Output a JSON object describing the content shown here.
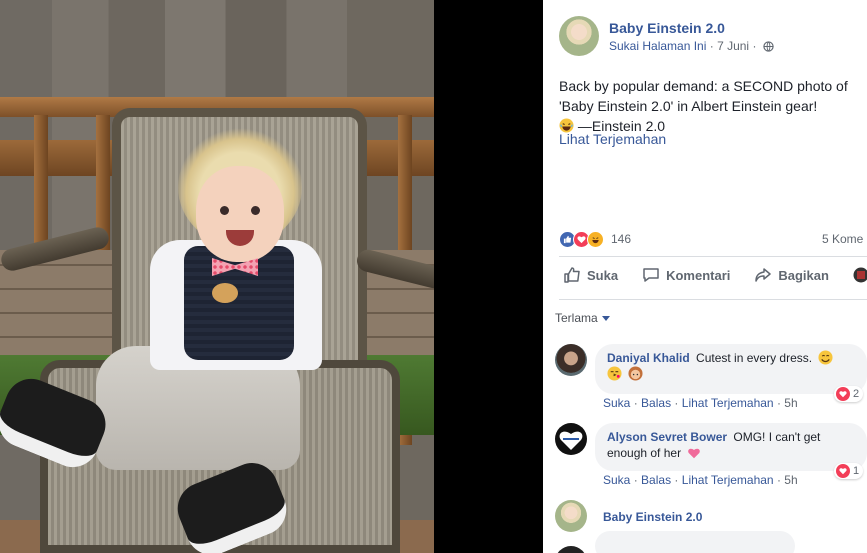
{
  "post": {
    "page_name": "Baby Einstein 2.0",
    "like_page": "Sukai Halaman Ini",
    "separator": "·",
    "date": "7 Juni",
    "separator2": "·",
    "text_line1": "Back by popular demand: a SECOND photo of",
    "text_line2": "'Baby Einstein 2.0' in Albert Einstein gear!",
    "text_line3": " —Einstein 2.0",
    "see_translation": "Lihat Terjemahan",
    "reaction_count": "146",
    "comment_count": "5 Kome"
  },
  "actions": {
    "like": "Suka",
    "comment": "Komentari",
    "share": "Bagikan"
  },
  "sort": {
    "label": "Terlama"
  },
  "comments": [
    {
      "name": "Daniyal Khalid",
      "text": "Cutest in every dress.",
      "like": "Suka",
      "reply": "Balas",
      "translate": "Lihat Terjemahan",
      "dot": "·",
      "time": "5h",
      "reactions": "2"
    },
    {
      "name": "Alyson Sevret Bower",
      "text_line1": "OMG! I can't get",
      "text_line2": "enough of her",
      "like": "Suka",
      "reply": "Balas",
      "translate": "Lihat Terjemahan",
      "dot": "·",
      "time": "5h",
      "reactions": "1"
    },
    {
      "name": "Baby Einstein 2.0"
    }
  ],
  "colors": {
    "link": "#385898",
    "like_blue": "#4267b2",
    "love_red": "#f33e58",
    "haha_yellow": "#f7b125"
  },
  "icons": [
    "globe-icon",
    "like-icon",
    "comment-icon",
    "share-icon",
    "heart-icon",
    "grin-emoji-icon",
    "smile-emoji-icon",
    "kiss-emoji-icon",
    "girl-emoji-icon",
    "heart-emoji-icon",
    "caret-down-icon"
  ]
}
